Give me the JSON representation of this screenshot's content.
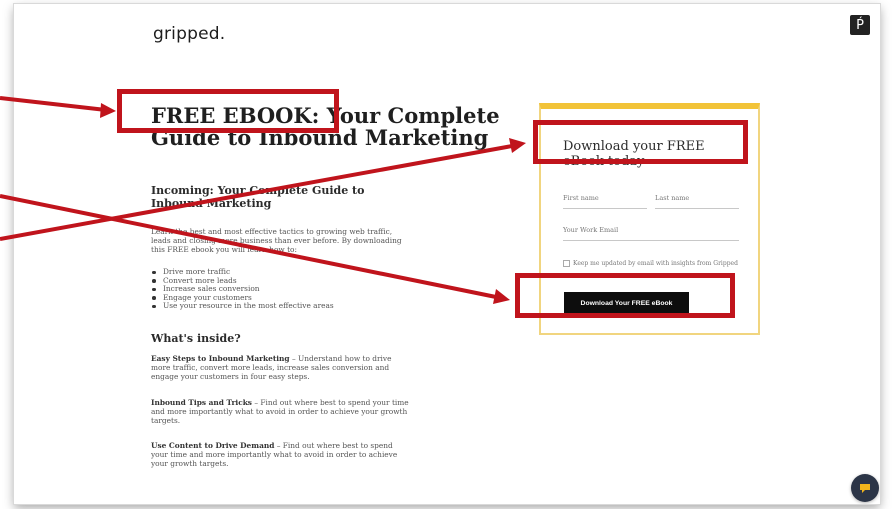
{
  "header": {
    "logo": "gripped.",
    "badge_icon": "hubspot-sprocket-icon",
    "badge_glyph": "Ṕ"
  },
  "hero": {
    "title": "FREE EBOOK: Your Complete Guide to Inbound Marketing",
    "subtitle": "Incoming: Your Complete Guide to Inbound Marketing",
    "intro": "Learn the best and most effective tactics to growing web traffic, leads and closing more business than ever before. By downloading this FREE ebook you will learn how to:",
    "bullets": [
      "Drive more traffic",
      "Convert more leads",
      "Increase sales conversion",
      "Engage your customers",
      "Use your resource in the most effective areas"
    ]
  },
  "inside": {
    "heading": "What's inside?",
    "sections": [
      {
        "title": "Easy Steps to Inbound Marketing",
        "text": " – Understand how to drive more traffic, convert more leads, increase sales conversion and engage your customers in four easy steps."
      },
      {
        "title": "Inbound Tips and Tricks",
        "text": " – Find out where best to spend your time and more importantly what to avoid in order to achieve your growth targets."
      },
      {
        "title": "Use Content to Drive Demand",
        "text": " – Find out where best to spend your time and more importantly what to avoid in order to achieve your growth targets."
      }
    ]
  },
  "form": {
    "title": "Download your FREE eBook today",
    "first_name_placeholder": "First name",
    "last_name_placeholder": "Last name",
    "email_placeholder": "Your Work Email",
    "consent": "Keep me updated by email with insights from Gripped",
    "button": "Download Your FREE eBook"
  },
  "colors": {
    "annotation": "#c0141c",
    "card_accent": "#f2c338",
    "button": "#0d0d0d",
    "chat": "#2c3547",
    "chat_dot": "#f2b51c"
  },
  "chat_icon": "chat-bubble-icon"
}
